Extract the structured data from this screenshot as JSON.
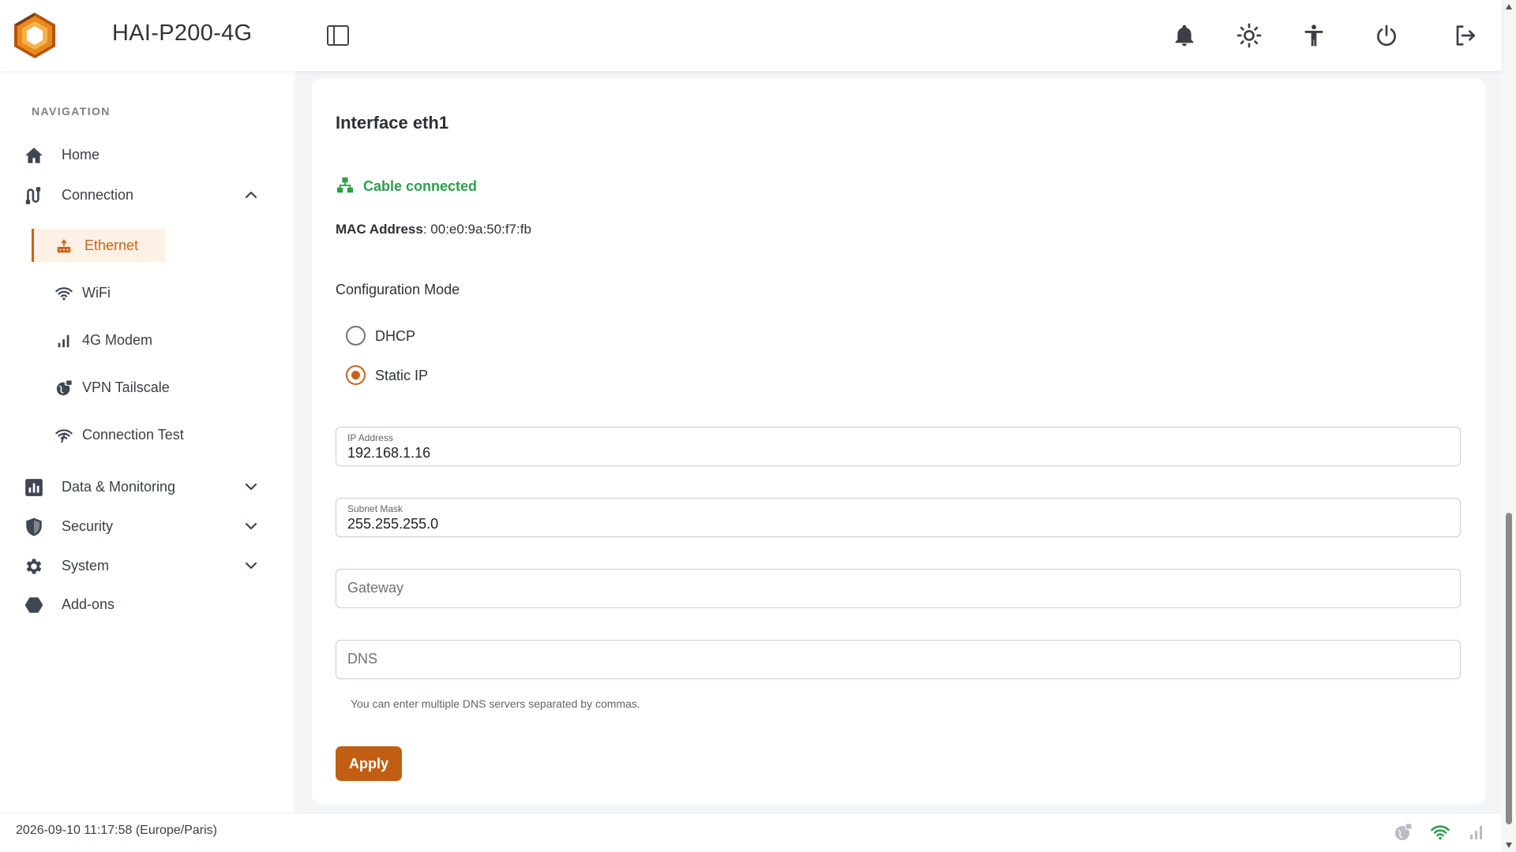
{
  "app": {
    "title": "HAI-P200-4G",
    "accent_color": "#c7641a",
    "success_color": "#2e9e4d"
  },
  "header": {
    "icons": [
      "sidebar-toggle-icon",
      "bell-icon",
      "sun-icon",
      "accessibility-icon",
      "power-icon",
      "logout-icon"
    ]
  },
  "sidebar": {
    "heading": "NAVIGATION",
    "items": [
      {
        "label": "Home",
        "icon": "home-icon"
      },
      {
        "label": "Connection",
        "icon": "connection-icon",
        "expanded": true
      },
      {
        "label": "Data & Monitoring",
        "icon": "chart-icon",
        "expanded": false
      },
      {
        "label": "Security",
        "icon": "shield-icon",
        "expanded": false
      },
      {
        "label": "System",
        "icon": "gear-icon",
        "expanded": false
      },
      {
        "label": "Add-ons",
        "icon": "hexagon-icon"
      }
    ],
    "connection_children": [
      {
        "label": "Ethernet",
        "icon": "ethernet-icon",
        "active": true
      },
      {
        "label": "WiFi",
        "icon": "wifi-icon"
      },
      {
        "label": "4G Modem",
        "icon": "signal-bars-icon"
      },
      {
        "label": "VPN Tailscale",
        "icon": "vpn-globe-icon"
      },
      {
        "label": "Connection Test",
        "icon": "wifi-test-icon"
      }
    ]
  },
  "main": {
    "title": "Interface eth1",
    "cable_status": "Cable connected",
    "mac_label": "MAC Address",
    "mac_value": "00:e0:9a:50:f7:fb",
    "config_mode_label": "Configuration Mode",
    "modes": [
      {
        "label": "DHCP",
        "checked": false
      },
      {
        "label": "Static IP",
        "checked": true
      }
    ],
    "fields": {
      "ip": {
        "label": "IP Address",
        "value": "192.168.1.16"
      },
      "subnet": {
        "label": "Subnet Mask",
        "value": "255.255.255.0"
      },
      "gateway": {
        "placeholder": "Gateway",
        "value": ""
      },
      "dns": {
        "placeholder": "DNS",
        "value": ""
      }
    },
    "dns_helper": "You can enter multiple DNS servers separated by commas.",
    "apply_label": "Apply"
  },
  "footer": {
    "datetime": "2026-09-10 11:17:58 (Europe/Paris)",
    "status_icons": [
      "vpn-status-icon",
      "wifi-status-icon",
      "signal-status-icon"
    ]
  }
}
